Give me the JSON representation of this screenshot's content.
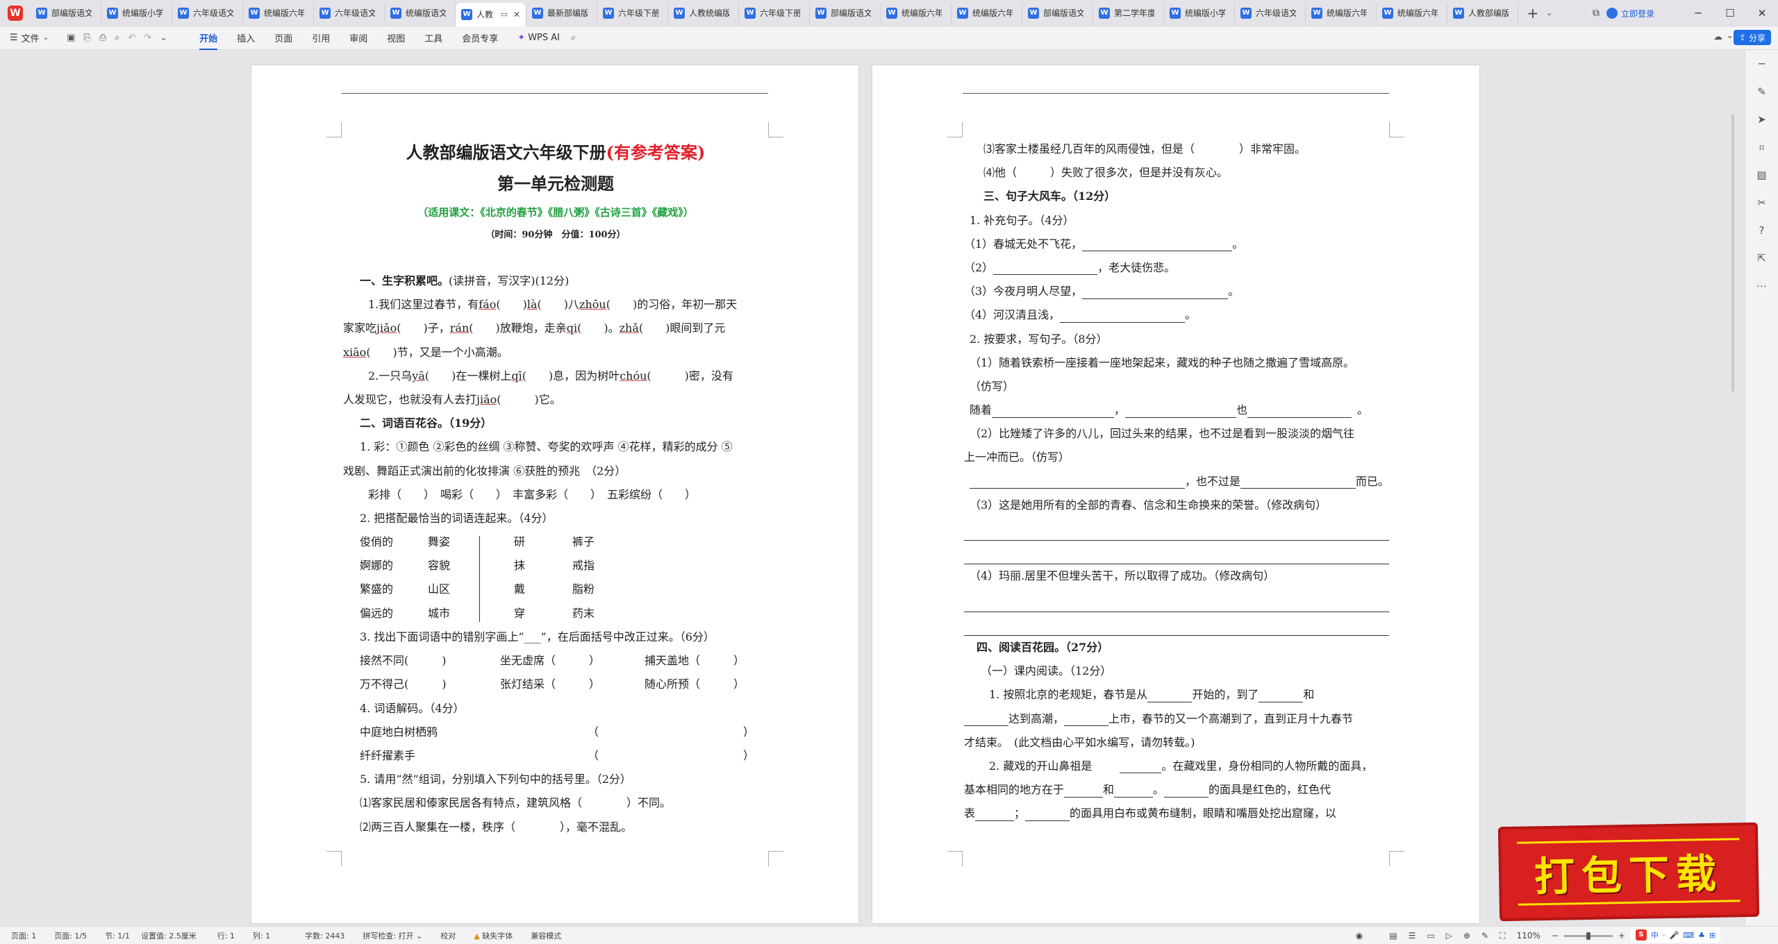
{
  "tabbar": {
    "tabs": [
      {
        "label": "部编版语文"
      },
      {
        "label": "统编版小学"
      },
      {
        "label": "六年级语文"
      },
      {
        "label": "统编版六年"
      },
      {
        "label": "六年级语文"
      },
      {
        "label": "统编版语文"
      },
      {
        "label": "人教",
        "active": true
      },
      {
        "label": "最新部编版"
      },
      {
        "label": "六年级下册"
      },
      {
        "label": "人教统编版"
      },
      {
        "label": "六年级下册"
      },
      {
        "label": "部编版语文"
      },
      {
        "label": "统编版六年"
      },
      {
        "label": "统编版六年"
      },
      {
        "label": "部编版语文"
      },
      {
        "label": "第二学年度"
      },
      {
        "label": "统编版小学"
      },
      {
        "label": "六年级语文"
      },
      {
        "label": "统编版六年"
      },
      {
        "label": "统编版六年"
      },
      {
        "label": "人教部编版"
      }
    ],
    "plus": "+",
    "login": "立即登录"
  },
  "toolbar": {
    "file": "文件",
    "menus": [
      "开始",
      "插入",
      "页面",
      "引用",
      "审阅",
      "视图",
      "工具",
      "会员专享"
    ],
    "active_menu": "开始",
    "ai": "WPS AI",
    "share": "分享"
  },
  "page1": {
    "title_main": "人教部编版语文六年级下册",
    "title_red": "(有参考答案)",
    "subtitle": "第一单元检测题",
    "lessons": "（适用课文：《北京的春节》《腊八粥》《古诗三首》《藏戏》）",
    "time": "（时间：90分钟　分值：100分）",
    "s1": "一、生字积累吧。",
    "s1_note": "(读拼音，写汉字)(12分)",
    "p1a": "1.我们这里过春节，有",
    "py1": "fáo",
    "p1b": "(　　)",
    "py2": "là",
    "p1c": "(　　)八",
    "py3": "zhōu",
    "p1d": "(　　)的习俗，年初一那天",
    "p2a": "家家吃",
    "py4": "jiǎo",
    "p2b": "(　　)子，",
    "py5": "rán",
    "p2c": "(　　)放鞭炮，走亲",
    "py6": "qi",
    "p2d": "(　　)。",
    "py7": "zhǎ",
    "p2e": "(　　)眼间到了元",
    "py8": "xiāo",
    "p3b": "(　　)节，又是一个小高潮。",
    "p4a": "2.一只乌",
    "py9": "yā",
    "p4b": "(　　)在一棵树上",
    "py10": "qī",
    "p4c": "(　　)息，因为树叶",
    "py11": "chóu",
    "p4d": "(　　　)密，没有",
    "p5a": "人发现它，也就没有人去打",
    "py12": "jiǎo",
    "p5b": "(　　　)它。",
    "s2": "二、词语百花谷。（19分）",
    "q1a": "1. 彩：①颜色 ②彩色的丝绸 ③称赞、夸奖的欢呼声 ④花样，精彩的成分 ⑤",
    "q1b": "戏剧、舞蹈正式演出前的化妆排演 ⑥获胜的预兆　（2分）",
    "q1c": "彩排（　　）　喝彩（　　）　丰富多彩（　　）　五彩缤纷（　　）",
    "q2": "2. 把搭配最恰当的词语连起来。（4分）",
    "match_a": [
      "俊俏的",
      "婀娜的",
      "繁盛的",
      "偏远的"
    ],
    "match_b": [
      "舞姿",
      "容貌",
      "山区",
      "城市"
    ],
    "match_c": [
      "研",
      "抹",
      "戴",
      "穿"
    ],
    "match_d": [
      "裤子",
      "戒指",
      "脂粉",
      "药末"
    ],
    "q3": "3. 找出下面词语中的错别字画上“___”，在后面括号中改正过来。（6分）",
    "q3r1": [
      "接然不同(　　　)",
      "坐无虚席（　　　）",
      "捕天盖地（　　　）"
    ],
    "q3r2": [
      "万不得己(　　　)",
      "张灯结采（　　　）",
      "随心所预（　　　）"
    ],
    "q4": "4. 词语解码。（4分）",
    "q4r1": "中庭地白树栖鸦",
    "q4r2": "纤纤擢素手",
    "q4paren": "（　　　　　　　　　　　　　）",
    "q5": "5. 请用“然”组词，分别填入下列句中的括号里。（2分）",
    "q5a": "⑴客家民居和傣家民居各有特点，建筑风格（　　　　）不同。",
    "q5b": "⑵两三百人聚集在一楼，秩序（　　　　），毫不混乱。"
  },
  "page2": {
    "l1": "⑶客家土楼虽经几百年的风雨侵蚀，但是（　　　　）非常牢固。",
    "l2": "⑷他（　　　）失败了很多次，但是并没有灰心。",
    "s3": "三、句子大风车。（12分）",
    "l3": "1. 补充句子。（4分）",
    "l4": "（1）春城无处不飞花，",
    "l5a": "（2）",
    "l5b": "，老大徒伤悲。",
    "l6": "（3）今夜月明人尽望，",
    "l7": "（4）河汉清且浅，",
    "l8": "2. 按要求，写句子。（8分）",
    "l9": "（1）随着铁索桥一座接着一座地架起来，藏戏的种子也随之撒遍了雪域高原。",
    "l10": "（仿写）",
    "l11a": "随着",
    "l11b": "，",
    "l11c": "也",
    "l11d": "。",
    "l12": "（2）比矬矮了许多的八儿，回过头来的结果，也不过是看到一股淡淡的烟气往",
    "l13": "上一冲而已。（仿写）",
    "l14a": "，也不过是",
    "l14b": "而已。",
    "l15": "（3）这是她用所有的全部的青春、信念和生命换来的荣誉。（修改病句）",
    "l16": "（4）玛丽.居里不但埋头苦干，所以取得了成功。（修改病句）",
    "s4": "四、阅读百花园。（27分）",
    "l17": "（一）课内阅读。（12分）",
    "l18a": "1. 按照北京的老规矩，春节是从",
    "l18b": "开始的，到了",
    "l18c": "和",
    "l19a": "达到高潮，",
    "l19b": "上市，春节的又一个高潮到了，直到正月十九春节",
    "l20": "才结束。　(此文档由心平如水编写，请勿转载。)",
    "l21a": "2. 藏戏的开山鼻祖是",
    "l21b": "。在藏戏里，身份相同的人物所戴的面具，",
    "l22a": "基本相同的地方在于",
    "l22b": "和",
    "l22c": "。",
    "l22d": "的面具是红色的，红色代",
    "l23a": "表",
    "l23b": "；",
    "l23c": "的面具用白布或黄布缝制，眼睛和嘴唇处挖出窟窿，以"
  },
  "statusbar": {
    "page": "页面: 1",
    "pages": "页面: 1/5",
    "section": "节: 1/1",
    "setting": "设置值: 2.5厘米",
    "row": "行: 1",
    "col": "列: 1",
    "words": "字数: 2443",
    "spell": "拼写检查: 打开",
    "proof": "校对",
    "missing_font": "缺失字体",
    "compat": "兼容模式",
    "zoom": "110%"
  },
  "tray": {
    "lang": "中"
  },
  "badge": {
    "text": "打包下载"
  }
}
